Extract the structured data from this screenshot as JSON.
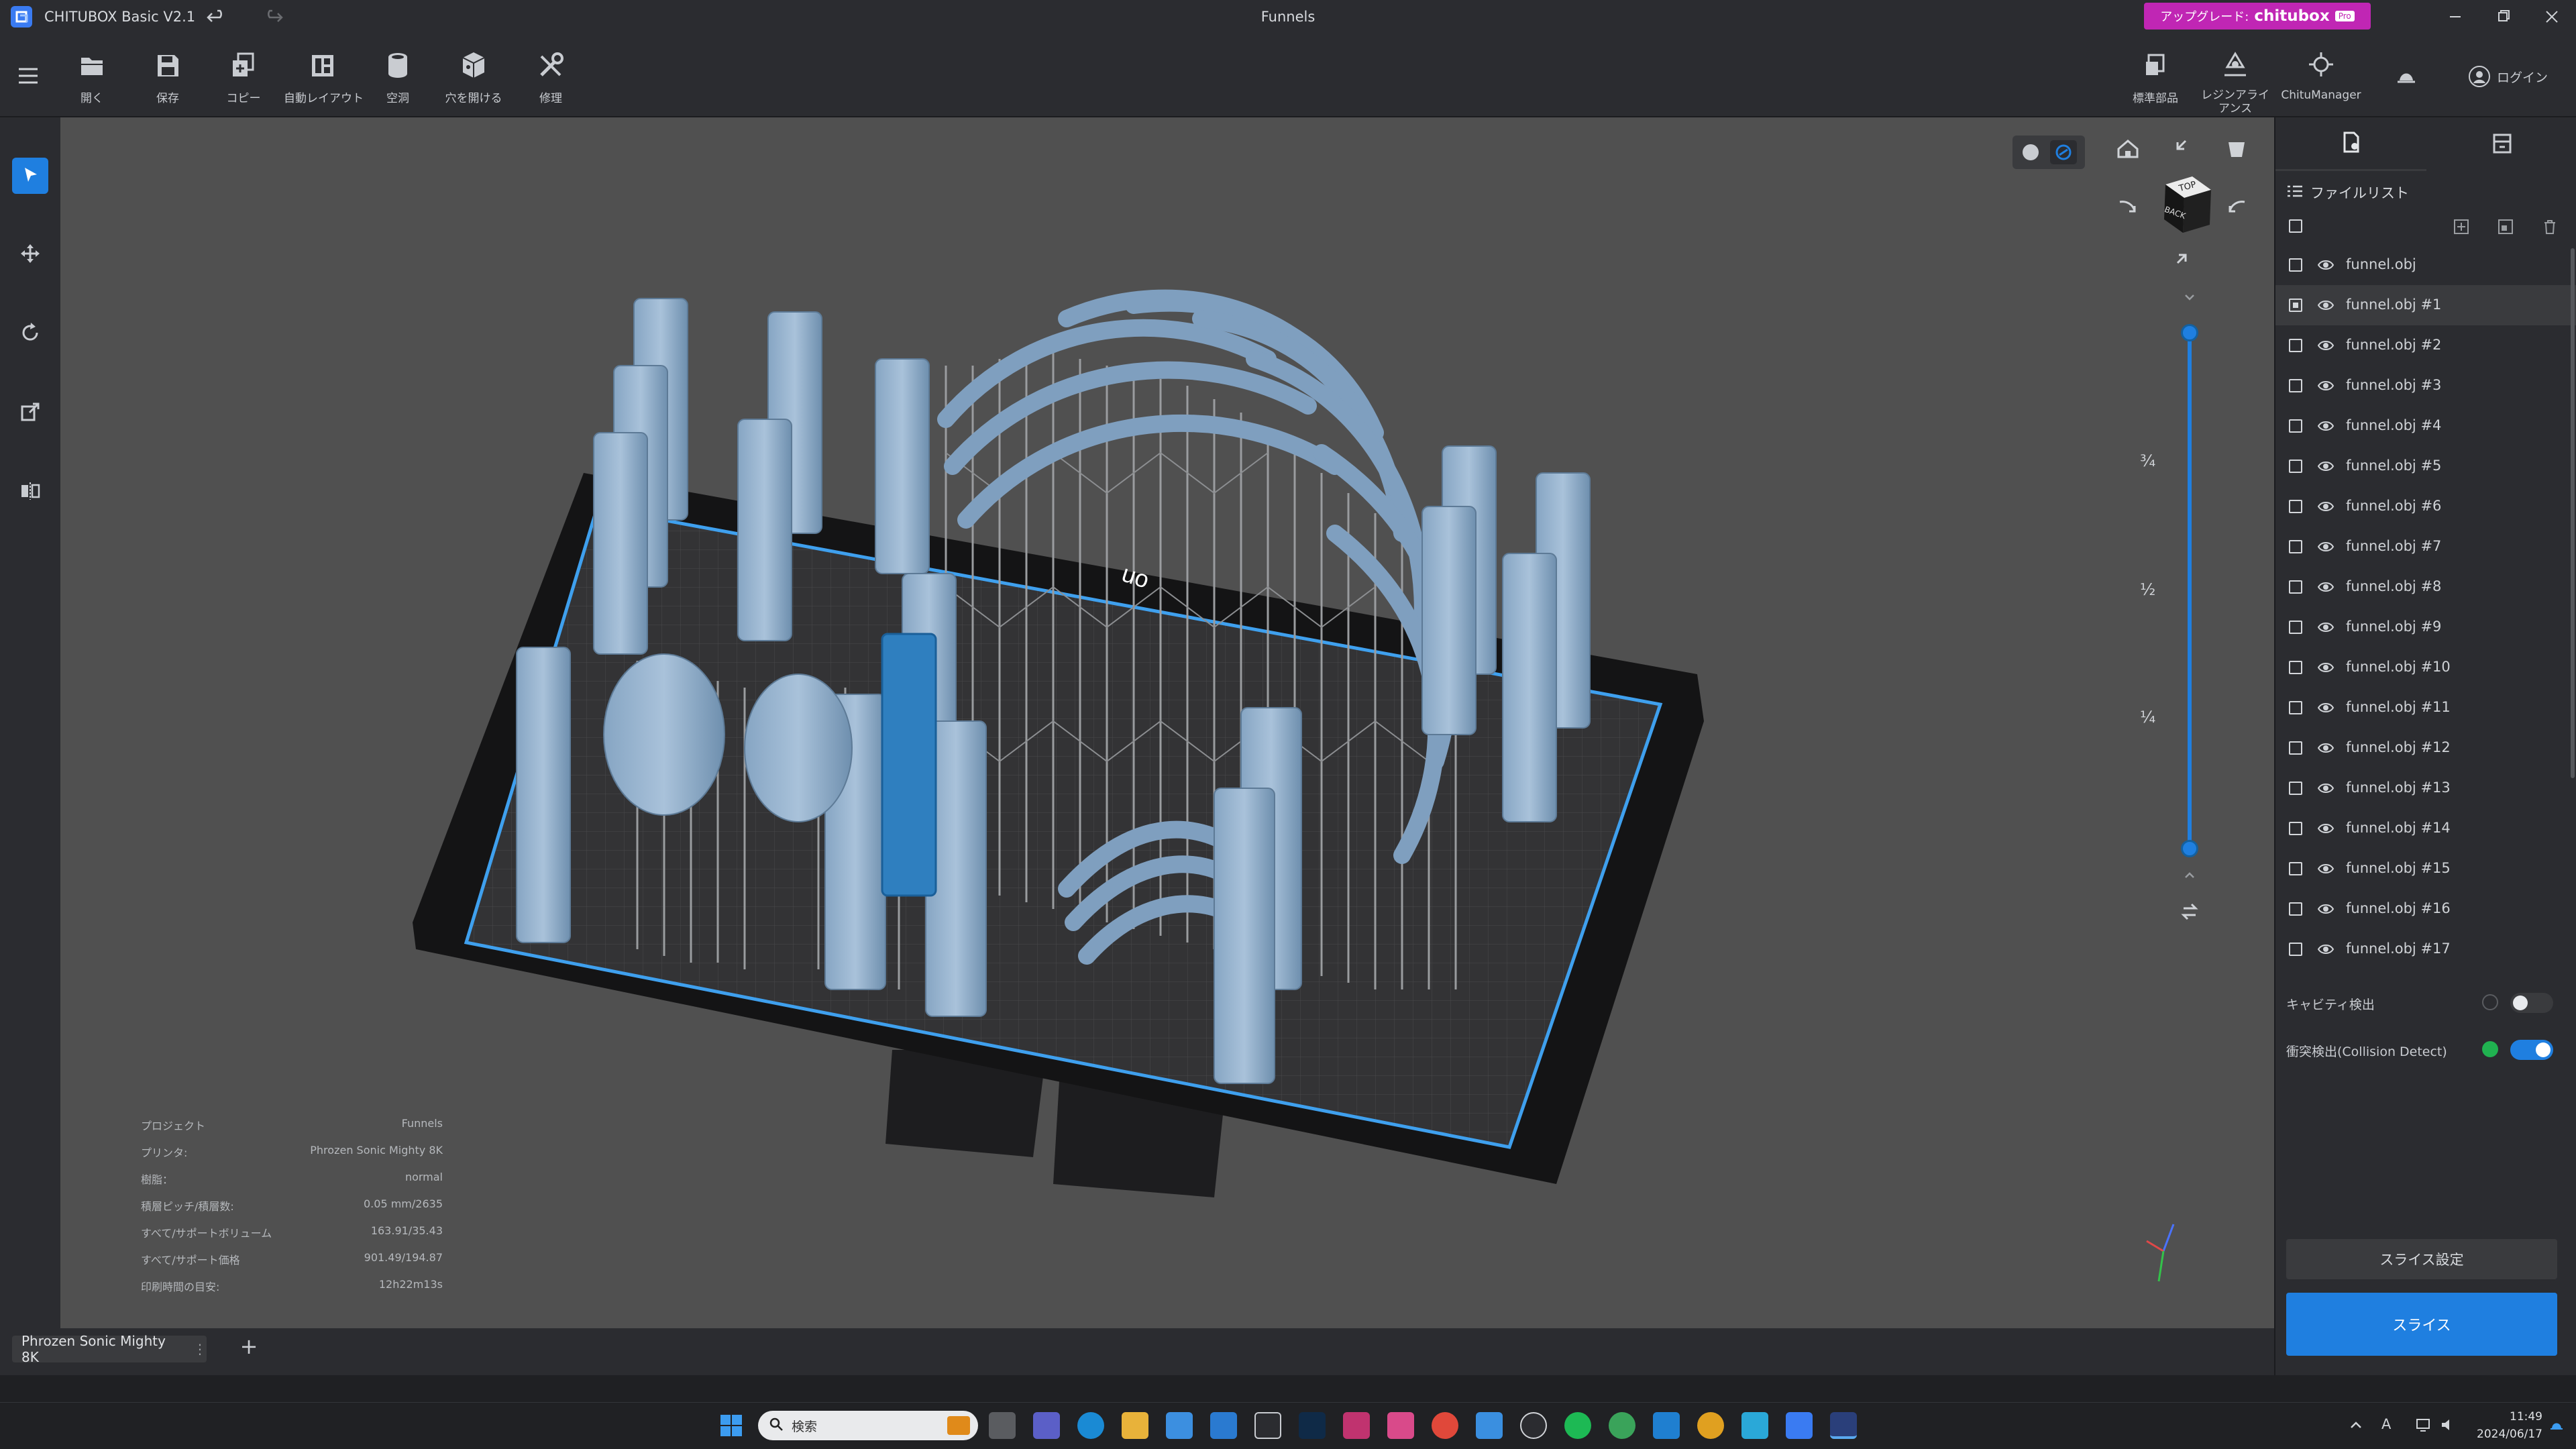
{
  "app": {
    "title": "CHITUBOX Basic V2.1",
    "document_title": "Funnels",
    "upgrade_label": "アップグレード:",
    "upgrade_brand": "chitubox",
    "upgrade_badge": "Pro",
    "accent": "#1f7fe0",
    "upgrade_color": "#c026b4"
  },
  "toolbar": {
    "items": [
      {
        "label": "開く",
        "icon": "folder-open-icon"
      },
      {
        "label": "保存",
        "icon": "save-icon"
      },
      {
        "label": "コピー",
        "icon": "copy-icon"
      },
      {
        "label": "自動レイアウト",
        "icon": "auto-layout-icon"
      },
      {
        "label": "空洞",
        "icon": "hollow-icon"
      },
      {
        "label": "穴を開ける",
        "icon": "drill-hole-icon"
      },
      {
        "label": "修理",
        "icon": "repair-icon"
      }
    ],
    "right_items": [
      {
        "label": "標準部品",
        "icon": "standard-parts-icon"
      },
      {
        "label": "レジンアライアンス",
        "icon": "resin-alliance-icon"
      },
      {
        "label": "ChituManager",
        "icon": "chitumanager-icon"
      }
    ],
    "login_label": "ログイン"
  },
  "viewport": {
    "slider_marks": [
      "¾",
      "½",
      "¼"
    ],
    "view_cube_top": "TOP",
    "view_cube_front": "BACK",
    "plate_text": "uo"
  },
  "file_list": {
    "title": "ファイルリスト",
    "items": [
      "funnel.obj",
      "funnel.obj #1",
      "funnel.obj #2",
      "funnel.obj #3",
      "funnel.obj #4",
      "funnel.obj #5",
      "funnel.obj #6",
      "funnel.obj #7",
      "funnel.obj #8",
      "funnel.obj #9",
      "funnel.obj #10",
      "funnel.obj #11",
      "funnel.obj #12",
      "funnel.obj #13",
      "funnel.obj #14",
      "funnel.obj #15",
      "funnel.obj #16",
      "funnel.obj #17"
    ],
    "selected": "funnel.obj #1"
  },
  "detection": {
    "cavity_label": "キャビティ検出",
    "cavity_on": false,
    "collision_label": "衝突検出(Collision Detect)",
    "collision_on": true
  },
  "slice": {
    "settings_label": "スライス設定",
    "slice_label": "スライス"
  },
  "info": {
    "rows": [
      {
        "k": "プロジェクト",
        "v": "Funnels"
      },
      {
        "k": "プリンタ:",
        "v": "Phrozen Sonic Mighty 8K"
      },
      {
        "k": "樹脂：",
        "v": "normal"
      },
      {
        "k": "積層ピッチ/積層数:",
        "v": "0.05 mm/2635"
      },
      {
        "k": "すべて/サポートボリューム",
        "v": "163.91/35.43"
      },
      {
        "k": "すべて/サポート価格",
        "v": "901.49/194.87"
      },
      {
        "k": "印刷時間の目安:",
        "v": "12h22m13s"
      }
    ]
  },
  "tabs": {
    "printer_tab": "Phrozen Sonic Mighty 8K",
    "add_label": "+"
  },
  "taskbar": {
    "search_placeholder": "検索",
    "time": "11:49",
    "date": "2024/06/17",
    "ime": "A"
  }
}
